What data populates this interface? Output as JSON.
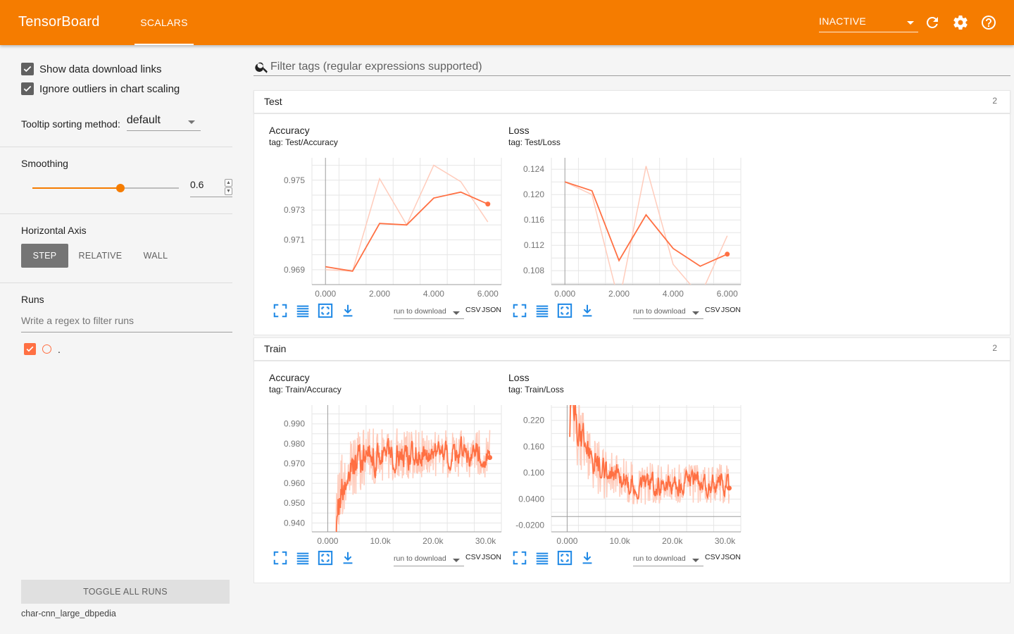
{
  "header": {
    "brand": "TensorBoard",
    "tab": "SCALARS",
    "status": "INACTIVE",
    "icons": [
      "reload-icon",
      "settings-icon",
      "help-icon"
    ]
  },
  "sidebar": {
    "show_download_links": "Show data download links",
    "ignore_outliers": "Ignore outliers in chart scaling",
    "tooltip_label": "Tooltip sorting method:",
    "tooltip_value": "default",
    "smoothing_label": "Smoothing",
    "smoothing_value": "0.6",
    "smoothing_fraction": 0.6,
    "horizontal_axis_label": "Horizontal Axis",
    "axis_buttons": [
      "STEP",
      "RELATIVE",
      "WALL"
    ],
    "runs_label": "Runs",
    "runs_placeholder": "Write a regex to filter runs",
    "run_name": ".",
    "toggle_all": "TOGGLE ALL RUNS",
    "logdir": "char-cnn_large_dbpedia"
  },
  "main": {
    "filter_placeholder": "Filter tags (regular expressions supported)",
    "run_to_download": "run to download",
    "csv": "CSV",
    "json": "JSON",
    "categories": [
      {
        "name": "Test",
        "count": "2"
      },
      {
        "name": "Train",
        "count": "2"
      }
    ]
  },
  "colors": {
    "accent": "#f57c00",
    "series": "#ff7043",
    "series_raw": "#ffccbc"
  },
  "chart_data": [
    {
      "type": "line",
      "title": "Accuracy",
      "tag": "tag: Test/Accuracy",
      "xlim": [
        -0.5,
        6.5
      ],
      "ylim": [
        0.968,
        0.9765
      ],
      "xticks": [
        0,
        2,
        4,
        6
      ],
      "xtick_labels": [
        "0.000",
        "2.000",
        "4.000",
        "6.000"
      ],
      "yticks": [
        0.969,
        0.971,
        0.973,
        0.975
      ],
      "ytick_labels": [
        "0.969",
        "0.971",
        "0.973",
        "0.975"
      ],
      "x": [
        0,
        1,
        2,
        3,
        4,
        5,
        6
      ],
      "raw": [
        0.969,
        0.9689,
        0.9751,
        0.972,
        0.976,
        0.9749,
        0.9722
      ],
      "smoothed": [
        0.9692,
        0.9689,
        0.9721,
        0.972,
        0.9738,
        0.9742,
        0.9734
      ]
    },
    {
      "type": "line",
      "title": "Loss",
      "tag": "tag: Test/Loss",
      "xlim": [
        -0.5,
        6.5
      ],
      "ylim": [
        0.1058,
        0.1258
      ],
      "xticks": [
        0,
        2,
        4,
        6
      ],
      "xtick_labels": [
        "0.000",
        "2.000",
        "4.000",
        "6.000"
      ],
      "yticks": [
        0.108,
        0.112,
        0.116,
        0.12,
        0.124
      ],
      "ytick_labels": [
        "0.108",
        "0.112",
        "0.116",
        "0.120",
        "0.124"
      ],
      "x": [
        0,
        1,
        2,
        3,
        4,
        5,
        6
      ],
      "raw": [
        0.122,
        0.12,
        0.103,
        0.1245,
        0.109,
        0.104,
        0.1135
      ],
      "smoothed": [
        0.122,
        0.1206,
        0.1096,
        0.1168,
        0.1115,
        0.1087,
        0.1106
      ]
    },
    {
      "type": "line",
      "title": "Accuracy",
      "tag": "tag: Train/Accuracy",
      "xlim": [
        -3000,
        33000
      ],
      "ylim": [
        0.9355,
        0.9995
      ],
      "xticks": [
        0,
        10000,
        20000,
        30000
      ],
      "xtick_labels": [
        "0.000",
        "10.0k",
        "20.0k",
        "30.0k"
      ],
      "yticks": [
        0.94,
        0.95,
        0.96,
        0.97,
        0.98,
        0.99
      ],
      "ytick_labels": [
        "0.940",
        "0.950",
        "0.960",
        "0.970",
        "0.980",
        "0.990"
      ],
      "x_range": [
        1500,
        30800
      ],
      "final": 0.973
    },
    {
      "type": "line",
      "title": "Loss",
      "tag": "tag: Train/Loss",
      "xlim": [
        -3000,
        33000
      ],
      "ylim": [
        -0.035,
        0.255
      ],
      "xticks": [
        0,
        10000,
        20000,
        30000
      ],
      "xtick_labels": [
        "0.000",
        "10.0k",
        "20.0k",
        "30.0k"
      ],
      "yticks": [
        -0.02,
        0.04,
        0.1,
        0.16,
        0.22
      ],
      "ytick_labels": [
        "-0.0200",
        "0.0400",
        "0.100",
        "0.160",
        "0.220"
      ],
      "x_range": [
        500,
        30800
      ],
      "final": 0.065
    }
  ]
}
